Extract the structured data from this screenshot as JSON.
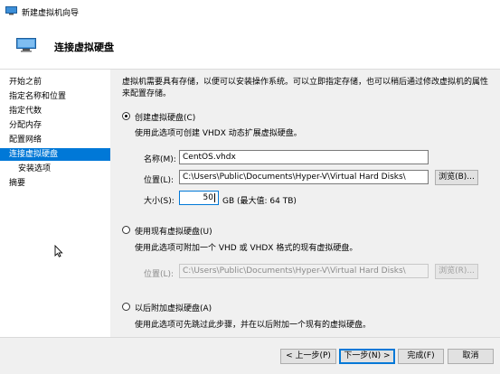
{
  "window": {
    "title": "新建虚拟机向导"
  },
  "header": {
    "title": "连接虚拟硬盘"
  },
  "sidebar": {
    "items": [
      {
        "label": "开始之前"
      },
      {
        "label": "指定名称和位置"
      },
      {
        "label": "指定代数"
      },
      {
        "label": "分配内存"
      },
      {
        "label": "配置网络"
      },
      {
        "label": "连接虚拟硬盘"
      },
      {
        "label": "安装选项"
      },
      {
        "label": "摘要"
      }
    ],
    "active_index": 5
  },
  "main": {
    "description": "虚拟机需要具有存储，以便可以安装操作系统。可以立即指定存储，也可以稍后通过修改虚拟机的属性来配置存储。",
    "create": {
      "label": "创建虚拟硬盘(C)",
      "selected": true,
      "desc": "使用此选项可创建 VHDX 动态扩展虚拟硬盘。",
      "name_label": "名称(M):",
      "name_value": "CentOS.vhdx",
      "location_label": "位置(L):",
      "location_value": "C:\\Users\\Public\\Documents\\Hyper-V\\Virtual Hard Disks\\",
      "browse_label": "浏览(B)...",
      "size_label": "大小(S):",
      "size_value": "50",
      "size_unit": "GB (最大值: 64 TB)"
    },
    "existing": {
      "label": "使用现有虚拟硬盘(U)",
      "selected": false,
      "desc": "使用此选项可附加一个 VHD 或 VHDX 格式的现有虚拟硬盘。",
      "location_label": "位置(L):",
      "location_value": "C:\\Users\\Public\\Documents\\Hyper-V\\Virtual Hard Disks\\",
      "browse_label": "浏览(R)..."
    },
    "later": {
      "label": "以后附加虚拟硬盘(A)",
      "selected": false,
      "desc": "使用此选项可先跳过此步骤，并在以后附加一个现有的虚拟硬盘。"
    }
  },
  "footer": {
    "prev_label": "< 上一步(P)",
    "next_label": "下一步(N) >",
    "finish_label": "完成(F)",
    "cancel_label": "取消"
  },
  "colors": {
    "accent": "#0078d7",
    "window_bg": "#f0f0f0",
    "panel_bg": "#ffffff"
  }
}
